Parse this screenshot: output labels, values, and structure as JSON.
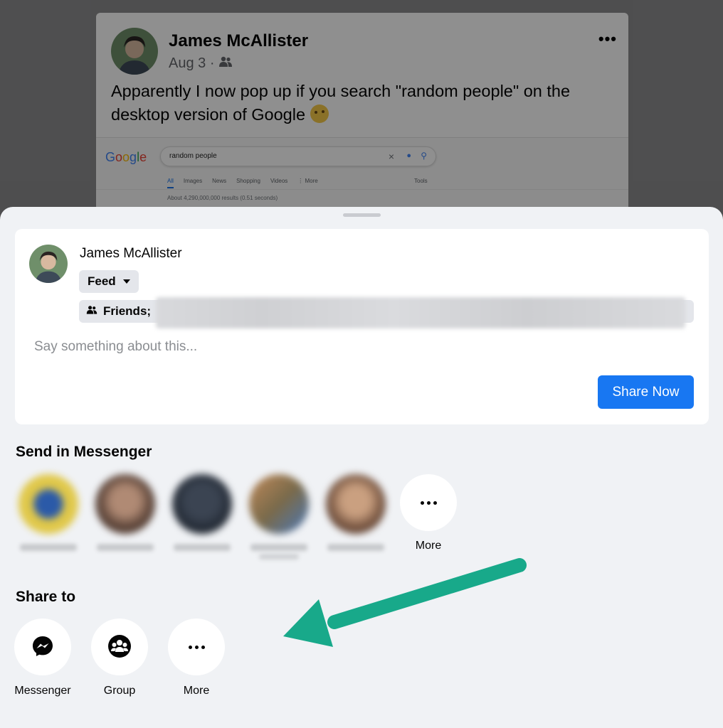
{
  "background_post": {
    "author": "James McAllister",
    "date": "Aug 3 ·",
    "audience_icon": "friends-icon",
    "more_icon": "more-horizontal-icon",
    "text": "Apparently I now pop up if you search \"random people\" on the desktop version of Google",
    "emoji": "face-with-raised-eyebrow-emoji",
    "embedded_search": {
      "logo": "Google",
      "query": "random people",
      "tabs": [
        "All",
        "Images",
        "News",
        "Shopping",
        "Videos",
        "⋮ More"
      ],
      "tools": "Tools",
      "results": "About 4,290,000,000 results (0.51 seconds)"
    }
  },
  "composer": {
    "author": "James McAllister",
    "destination": "Feed",
    "audience_prefix": "Friends;",
    "placeholder": "Say something about this...",
    "share_button": "Share Now"
  },
  "messenger_section": {
    "title": "Send in Messenger",
    "more_label": "More"
  },
  "share_to_section": {
    "title": "Share to",
    "targets": [
      {
        "label": "Messenger",
        "icon": "messenger-icon"
      },
      {
        "label": "Group",
        "icon": "group-icon"
      },
      {
        "label": "More",
        "icon": "more-horizontal-icon"
      }
    ]
  },
  "colors": {
    "primary_button": "#1877f2",
    "sheet_background": "#f0f2f5",
    "annotation_arrow": "#18a98a"
  }
}
